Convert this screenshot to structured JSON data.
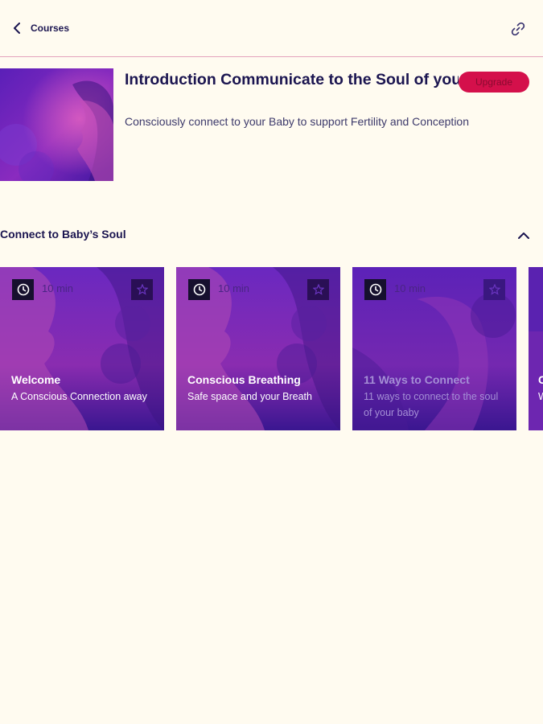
{
  "nav": {
    "back_label": "Courses",
    "back_icon": "chevron-left-icon",
    "share_icon": "link-icon"
  },
  "course": {
    "title": "Introduction Communicate to the Soul of your Baby",
    "subtitle": "Consciously connect to your Baby to support Fertility and Conception",
    "upgrade_label": "Upgrade"
  },
  "section": {
    "title": "Connect to Baby’s Soul",
    "toggle_icon": "chevron-up-icon",
    "cards": [
      {
        "duration": "10 min",
        "title": "Welcome",
        "subtitle": "A Conscious Connection away"
      },
      {
        "duration": "10 min",
        "title": "Conscious Breathing",
        "subtitle": "Safe space and your Breath"
      },
      {
        "duration": "10 min",
        "title": "11 Ways to Connect",
        "subtitle": "11 ways to connect to the soul of your baby"
      },
      {
        "duration": "",
        "title": "C",
        "subtitle": "W"
      }
    ]
  },
  "colors": {
    "background": "#fffbf0",
    "accent": "#d4104b",
    "text": "#1b1550",
    "card_purple": "#5b1fb0"
  }
}
